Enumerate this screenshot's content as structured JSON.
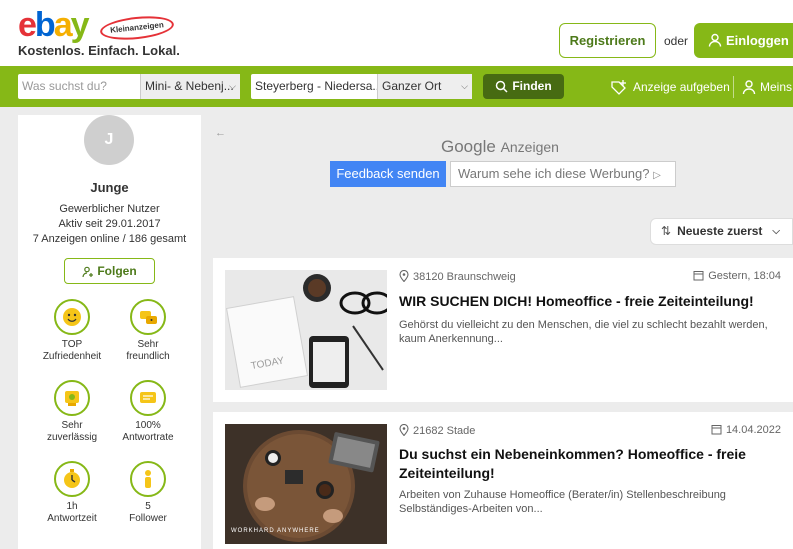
{
  "header": {
    "logo_letters": [
      "e",
      "b",
      "a",
      "y"
    ],
    "logo_colors": [
      "#e53238",
      "#0064d2",
      "#f5af02",
      "#86b817"
    ],
    "ka_badge": "Kleinanzeigen",
    "tagline": "Kostenlos. Einfach. Lokal.",
    "register_label": "Registrieren",
    "oder": "oder",
    "login_label": "Einloggen",
    "login_icon": "user-icon"
  },
  "search": {
    "placeholder": "Was suchst du?",
    "category": "Mini- & Nebenj...",
    "location": "Steyerberg - Niedersa...",
    "radius": "Ganzer Ort",
    "submit_label": "Finden",
    "post_ad_label": "Anzeige aufgeben",
    "mine_label": "Meins"
  },
  "profile": {
    "avatar_initial": "J",
    "name": "Junge",
    "type": "Gewerblicher Nutzer",
    "active_since": "Aktiv seit 29.01.2017",
    "ads_count": "7 Anzeigen online / 186 gesamt",
    "follow_label": "Folgen",
    "badges": [
      {
        "line1": "TOP",
        "line2": "Zufriedenheit",
        "icon": "smiley-icon"
      },
      {
        "line1": "Sehr",
        "line2": "freundlich",
        "icon": "chat-smiley-icon"
      },
      {
        "line1": "Sehr",
        "line2": "zuverlässig",
        "icon": "reliable-icon"
      },
      {
        "line1": "100%",
        "line2": "Antwortrate",
        "icon": "message-icon"
      },
      {
        "line1": "1h",
        "line2": "Antwortzeit",
        "icon": "stopwatch-icon"
      },
      {
        "line1": "5",
        "line2": "Follower",
        "icon": "person-icon"
      }
    ]
  },
  "ads_banner": {
    "google_label": "Google",
    "anzeigen_label": "Anzeigen",
    "feedback_label": "Feedback senden",
    "why_label": "Warum sehe ich diese Werbung?"
  },
  "sort": {
    "label": "Neueste zuerst"
  },
  "listings": [
    {
      "location": "38120 Braunschweig",
      "date": "Gestern, 18:04",
      "title": "WIR SUCHEN DICH! Homeoffice - freie Zeiteinteilung!",
      "desc": "Gehörst du vielleicht zu den Menschen, die viel zu schlecht bezahlt werden, kaum Anerkennung...",
      "thumb_text": "TODAY"
    },
    {
      "location": "21682 Stade",
      "date": "14.04.2022",
      "title": "Du suchst ein Nebeneinkommen? Homeoffice - freie Zeiteinteilung!",
      "desc": "Arbeiten von Zuhause Homeoffice (Berater/in) Stellenbeschreibung Selbständiges-Arbeiten von...",
      "thumb_text": "WORKHARD ANYWHERE"
    }
  ]
}
